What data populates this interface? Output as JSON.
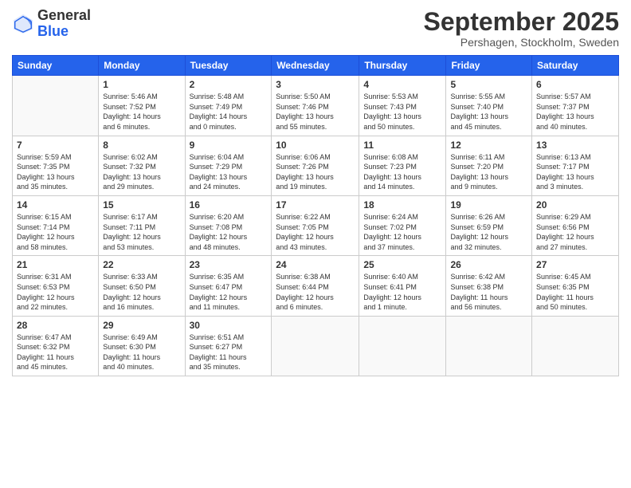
{
  "header": {
    "logo_general": "General",
    "logo_blue": "Blue",
    "month_title": "September 2025",
    "location": "Pershagen, Stockholm, Sweden"
  },
  "weekdays": [
    "Sunday",
    "Monday",
    "Tuesday",
    "Wednesday",
    "Thursday",
    "Friday",
    "Saturday"
  ],
  "weeks": [
    [
      {
        "day": "",
        "info": ""
      },
      {
        "day": "1",
        "info": "Sunrise: 5:46 AM\nSunset: 7:52 PM\nDaylight: 14 hours\nand 6 minutes."
      },
      {
        "day": "2",
        "info": "Sunrise: 5:48 AM\nSunset: 7:49 PM\nDaylight: 14 hours\nand 0 minutes."
      },
      {
        "day": "3",
        "info": "Sunrise: 5:50 AM\nSunset: 7:46 PM\nDaylight: 13 hours\nand 55 minutes."
      },
      {
        "day": "4",
        "info": "Sunrise: 5:53 AM\nSunset: 7:43 PM\nDaylight: 13 hours\nand 50 minutes."
      },
      {
        "day": "5",
        "info": "Sunrise: 5:55 AM\nSunset: 7:40 PM\nDaylight: 13 hours\nand 45 minutes."
      },
      {
        "day": "6",
        "info": "Sunrise: 5:57 AM\nSunset: 7:37 PM\nDaylight: 13 hours\nand 40 minutes."
      }
    ],
    [
      {
        "day": "7",
        "info": "Sunrise: 5:59 AM\nSunset: 7:35 PM\nDaylight: 13 hours\nand 35 minutes."
      },
      {
        "day": "8",
        "info": "Sunrise: 6:02 AM\nSunset: 7:32 PM\nDaylight: 13 hours\nand 29 minutes."
      },
      {
        "day": "9",
        "info": "Sunrise: 6:04 AM\nSunset: 7:29 PM\nDaylight: 13 hours\nand 24 minutes."
      },
      {
        "day": "10",
        "info": "Sunrise: 6:06 AM\nSunset: 7:26 PM\nDaylight: 13 hours\nand 19 minutes."
      },
      {
        "day": "11",
        "info": "Sunrise: 6:08 AM\nSunset: 7:23 PM\nDaylight: 13 hours\nand 14 minutes."
      },
      {
        "day": "12",
        "info": "Sunrise: 6:11 AM\nSunset: 7:20 PM\nDaylight: 13 hours\nand 9 minutes."
      },
      {
        "day": "13",
        "info": "Sunrise: 6:13 AM\nSunset: 7:17 PM\nDaylight: 13 hours\nand 3 minutes."
      }
    ],
    [
      {
        "day": "14",
        "info": "Sunrise: 6:15 AM\nSunset: 7:14 PM\nDaylight: 12 hours\nand 58 minutes."
      },
      {
        "day": "15",
        "info": "Sunrise: 6:17 AM\nSunset: 7:11 PM\nDaylight: 12 hours\nand 53 minutes."
      },
      {
        "day": "16",
        "info": "Sunrise: 6:20 AM\nSunset: 7:08 PM\nDaylight: 12 hours\nand 48 minutes."
      },
      {
        "day": "17",
        "info": "Sunrise: 6:22 AM\nSunset: 7:05 PM\nDaylight: 12 hours\nand 43 minutes."
      },
      {
        "day": "18",
        "info": "Sunrise: 6:24 AM\nSunset: 7:02 PM\nDaylight: 12 hours\nand 37 minutes."
      },
      {
        "day": "19",
        "info": "Sunrise: 6:26 AM\nSunset: 6:59 PM\nDaylight: 12 hours\nand 32 minutes."
      },
      {
        "day": "20",
        "info": "Sunrise: 6:29 AM\nSunset: 6:56 PM\nDaylight: 12 hours\nand 27 minutes."
      }
    ],
    [
      {
        "day": "21",
        "info": "Sunrise: 6:31 AM\nSunset: 6:53 PM\nDaylight: 12 hours\nand 22 minutes."
      },
      {
        "day": "22",
        "info": "Sunrise: 6:33 AM\nSunset: 6:50 PM\nDaylight: 12 hours\nand 16 minutes."
      },
      {
        "day": "23",
        "info": "Sunrise: 6:35 AM\nSunset: 6:47 PM\nDaylight: 12 hours\nand 11 minutes."
      },
      {
        "day": "24",
        "info": "Sunrise: 6:38 AM\nSunset: 6:44 PM\nDaylight: 12 hours\nand 6 minutes."
      },
      {
        "day": "25",
        "info": "Sunrise: 6:40 AM\nSunset: 6:41 PM\nDaylight: 12 hours\nand 1 minute."
      },
      {
        "day": "26",
        "info": "Sunrise: 6:42 AM\nSunset: 6:38 PM\nDaylight: 11 hours\nand 56 minutes."
      },
      {
        "day": "27",
        "info": "Sunrise: 6:45 AM\nSunset: 6:35 PM\nDaylight: 11 hours\nand 50 minutes."
      }
    ],
    [
      {
        "day": "28",
        "info": "Sunrise: 6:47 AM\nSunset: 6:32 PM\nDaylight: 11 hours\nand 45 minutes."
      },
      {
        "day": "29",
        "info": "Sunrise: 6:49 AM\nSunset: 6:30 PM\nDaylight: 11 hours\nand 40 minutes."
      },
      {
        "day": "30",
        "info": "Sunrise: 6:51 AM\nSunset: 6:27 PM\nDaylight: 11 hours\nand 35 minutes."
      },
      {
        "day": "",
        "info": ""
      },
      {
        "day": "",
        "info": ""
      },
      {
        "day": "",
        "info": ""
      },
      {
        "day": "",
        "info": ""
      }
    ]
  ]
}
